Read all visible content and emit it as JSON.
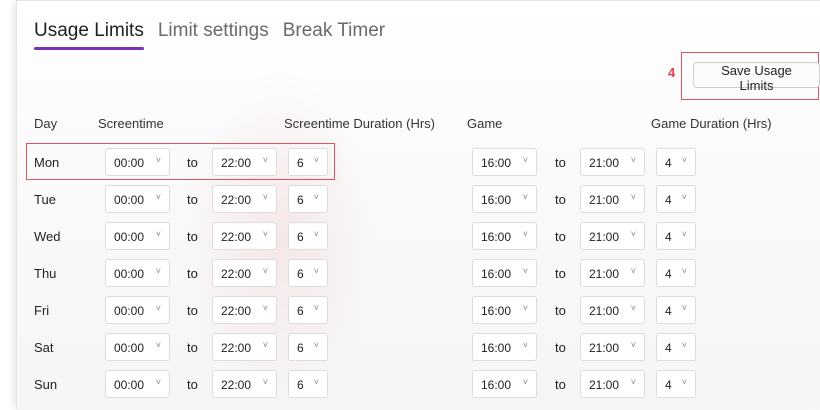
{
  "tabs": [
    "Usage Limits",
    "Limit settings",
    "Break Timer"
  ],
  "save": {
    "badge": "4",
    "label": "Save Usage Limits"
  },
  "headers": {
    "day": "Day",
    "screentime": "Screentime",
    "screentime_duration": "Screentime Duration (Hrs)",
    "game": "Game",
    "game_duration": "Game Duration (Hrs)"
  },
  "to_label": "to",
  "chevron": "˅",
  "rows": [
    {
      "day": "Mon",
      "s_from": "00:00",
      "s_to": "22:00",
      "s_dur": "6",
      "g_from": "16:00",
      "g_to": "21:00",
      "g_dur": "4"
    },
    {
      "day": "Tue",
      "s_from": "00:00",
      "s_to": "22:00",
      "s_dur": "6",
      "g_from": "16:00",
      "g_to": "21:00",
      "g_dur": "4"
    },
    {
      "day": "Wed",
      "s_from": "00:00",
      "s_to": "22:00",
      "s_dur": "6",
      "g_from": "16:00",
      "g_to": "21:00",
      "g_dur": "4"
    },
    {
      "day": "Thu",
      "s_from": "00:00",
      "s_to": "22:00",
      "s_dur": "6",
      "g_from": "16:00",
      "g_to": "21:00",
      "g_dur": "4"
    },
    {
      "day": "Fri",
      "s_from": "00:00",
      "s_to": "22:00",
      "s_dur": "6",
      "g_from": "16:00",
      "g_to": "21:00",
      "g_dur": "4"
    },
    {
      "day": "Sat",
      "s_from": "00:00",
      "s_to": "22:00",
      "s_dur": "6",
      "g_from": "16:00",
      "g_to": "21:00",
      "g_dur": "4"
    },
    {
      "day": "Sun",
      "s_from": "00:00",
      "s_to": "22:00",
      "s_dur": "6",
      "g_from": "16:00",
      "g_to": "21:00",
      "g_dur": "4"
    }
  ],
  "colors": {
    "accent": "#7a2fb8",
    "highlight": "#e0545e"
  }
}
